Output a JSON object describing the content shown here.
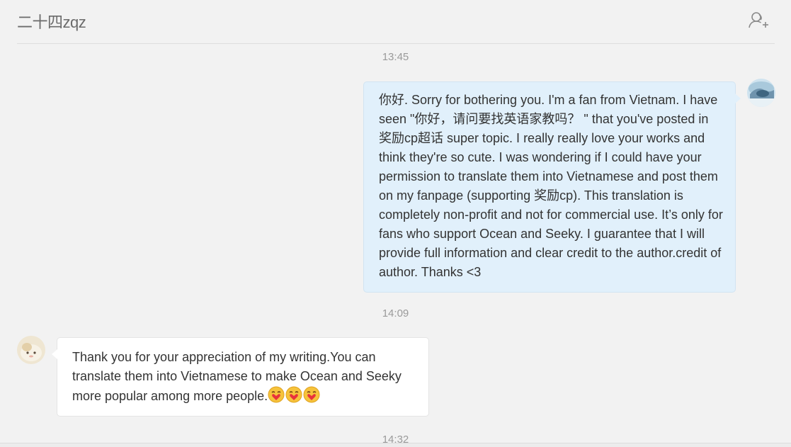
{
  "header": {
    "title": "二十四zqz",
    "add_contact_icon": "add-contact-icon"
  },
  "messages": [
    {
      "timestamp": "13:45",
      "direction": "outgoing",
      "text": "你好. Sorry for bothering you. I'm a fan from Vietnam. I have seen \"你好，请问要找英语家教吗？ \" that you've posted in 奖励cp超话  super topic. I really really love your works and think they're so cute. I was wondering if I could have your permission to translate them into Vietnamese and post them on my fanpage (supporting 奖励cp). This translation is completely non-profit and not for commercial use. It’s only for fans who support Ocean and Seeky. I guarantee that I will provide full information and clear credit to the author.credit of author. Thanks <3"
    },
    {
      "timestamp": "14:09",
      "direction": "incoming",
      "text": "Thank you for your appreciation of my writing.You can translate them into Vietnamese to make Ocean and Seeky more popular among more people.",
      "emojis": [
        "heart-kiss-emoji",
        "heart-kiss-emoji",
        "heart-kiss-emoji"
      ]
    },
    {
      "timestamp": "14:32"
    }
  ],
  "colors": {
    "background": "#f2f2f2",
    "outgoing_bubble": "#e1f0fb",
    "incoming_bubble": "#ffffff",
    "text": "#333333",
    "timestamp": "#9a9a9a"
  }
}
